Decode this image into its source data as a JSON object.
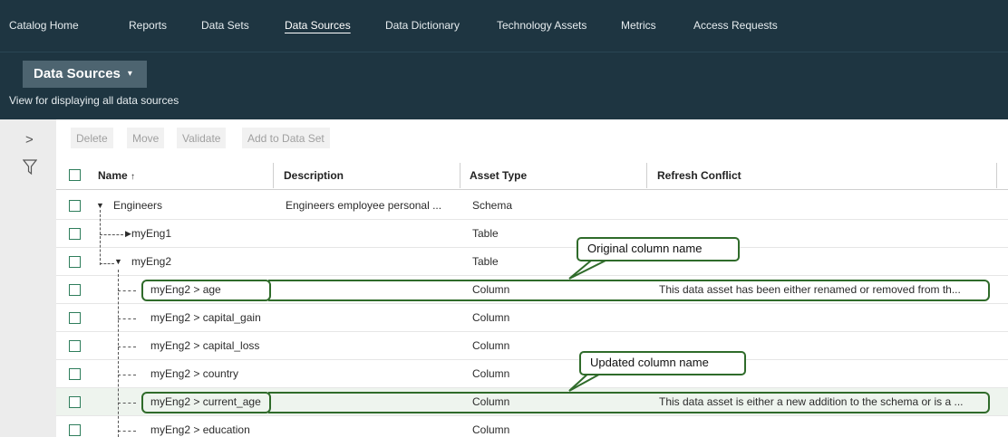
{
  "nav": {
    "items": [
      {
        "label": "Catalog Home",
        "active": false
      },
      {
        "label": "Reports",
        "active": false
      },
      {
        "label": "Data Sets",
        "active": false
      },
      {
        "label": "Data Sources",
        "active": true
      },
      {
        "label": "Data Dictionary",
        "active": false
      },
      {
        "label": "Technology Assets",
        "active": false
      },
      {
        "label": "Metrics",
        "active": false
      },
      {
        "label": "Access Requests",
        "active": false
      }
    ]
  },
  "view": {
    "title": "Data Sources",
    "caret": "▾",
    "description": "View for displaying all data sources"
  },
  "rail": {
    "expand_icon": "chevron-right-icon",
    "expand_glyph": ">",
    "filter_icon": "filter-icon"
  },
  "toolbar": {
    "delete_label": "Delete",
    "move_label": "Move",
    "validate_label": "Validate",
    "add_label": "Add to Data Set"
  },
  "table": {
    "columns": {
      "name": "Name",
      "sort_glyph": "↑",
      "description": "Description",
      "asset_type": "Asset Type",
      "refresh_conflict": "Refresh Conflict"
    },
    "rows": [
      {
        "name": "Engineers",
        "description": "Engineers employee personal ...",
        "asset_type": "Schema",
        "conflict": ""
      },
      {
        "name": "myEng1",
        "description": "",
        "asset_type": "Table",
        "conflict": ""
      },
      {
        "name": "myEng2",
        "description": "",
        "asset_type": "Table",
        "conflict": ""
      },
      {
        "name": "myEng2 > age",
        "description": "",
        "asset_type": "Column",
        "conflict": "This data asset has been either renamed or removed from th..."
      },
      {
        "name": "myEng2 > capital_gain",
        "description": "",
        "asset_type": "Column",
        "conflict": ""
      },
      {
        "name": "myEng2 > capital_loss",
        "description": "",
        "asset_type": "Column",
        "conflict": ""
      },
      {
        "name": "myEng2 > country",
        "description": "",
        "asset_type": "Column",
        "conflict": ""
      },
      {
        "name": "myEng2 > current_age",
        "description": "",
        "asset_type": "Column",
        "conflict": "This data asset is either a new addition to the schema or is a ..."
      },
      {
        "name": "myEng2 > education",
        "description": "",
        "asset_type": "Column",
        "conflict": ""
      }
    ]
  },
  "annotations": {
    "original": "Original column name",
    "updated": "Updated column name"
  },
  "colors": {
    "nav_bg": "#1e3541",
    "accent_green": "#2e7d5b",
    "callout_border": "#2f6b2a"
  }
}
